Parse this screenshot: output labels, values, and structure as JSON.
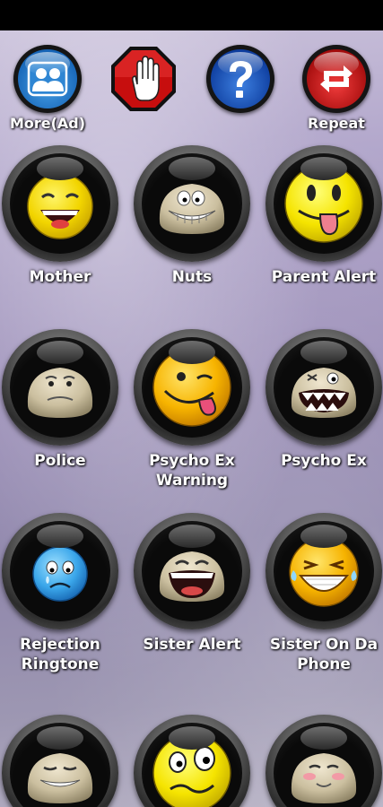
{
  "toolbar": {
    "more": {
      "label": "More(Ad)",
      "icon": "people-icon"
    },
    "stop": {
      "label": "",
      "icon": "stop-hand-icon"
    },
    "help": {
      "label": "",
      "icon": "question-mark-icon"
    },
    "repeat": {
      "label": "Repeat",
      "icon": "repeat-icon"
    }
  },
  "sounds": [
    {
      "label": "Mother",
      "icon": "laughing-yellow-smiley-icon"
    },
    {
      "label": "Nuts",
      "icon": "grinning-stone-face-icon"
    },
    {
      "label": "Parent Alert",
      "icon": "tongue-out-yellow-smiley-icon"
    },
    {
      "label": "Police",
      "icon": "worried-stone-face-icon"
    },
    {
      "label": "Psycho Ex Warning",
      "icon": "winking-tongue-smiley-icon"
    },
    {
      "label": "Psycho Ex",
      "icon": "crazy-stone-face-icon"
    },
    {
      "label": "Rejection Ringtone",
      "icon": "crying-blue-smiley-icon"
    },
    {
      "label": "Sister Alert",
      "icon": "laughing-stone-face-icon"
    },
    {
      "label": "Sister On Da Phone",
      "icon": "laughing-tears-smiley-icon"
    },
    {
      "label": "",
      "icon": "sleepy-stone-face-icon"
    },
    {
      "label": "",
      "icon": "confused-yellow-smiley-icon"
    },
    {
      "label": "",
      "icon": "blushing-stone-face-icon"
    }
  ],
  "colors": {
    "background_top": "#c9c0da",
    "background_bottom": "#8f86ab",
    "label": "#ffffff"
  }
}
